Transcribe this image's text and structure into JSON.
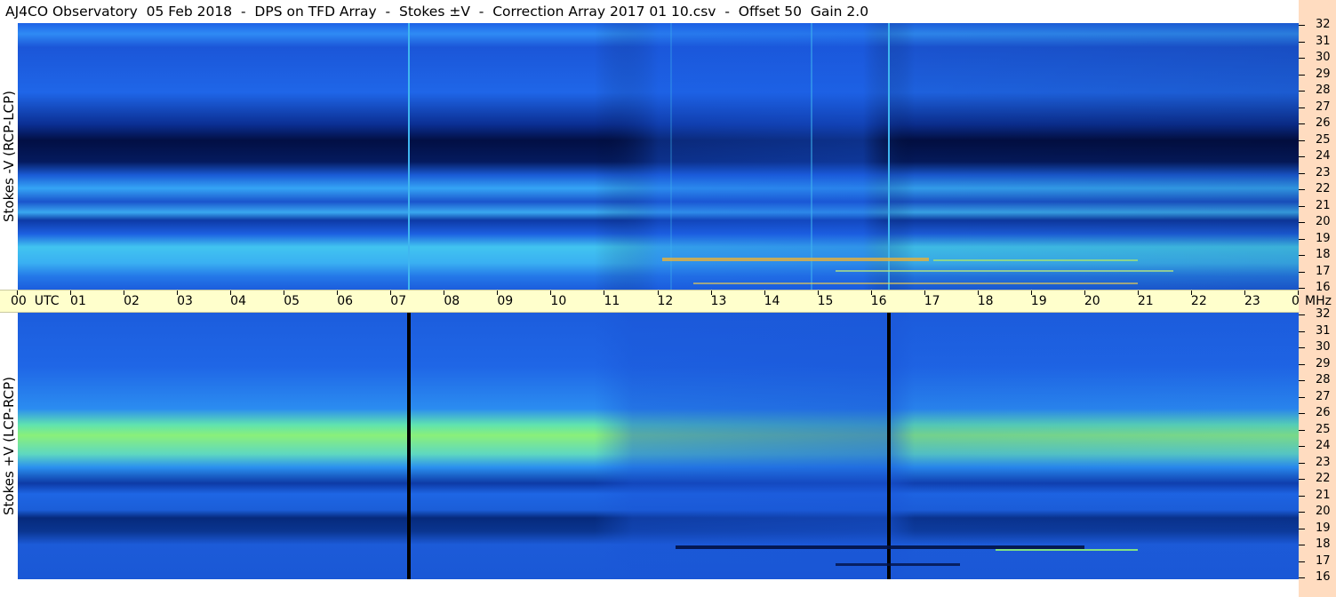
{
  "title": "AJ4CO Observatory  05 Feb 2018  -  DPS on TFD Array  -  Stokes ±V  -  Correction Array 2017 01 10.csv  -  Offset 50  Gain 2.0",
  "top_panel": {
    "label": "Stokes -V (RCP-LCP)"
  },
  "bottom_panel": {
    "label": "Stokes +V (LCP-RCP)"
  },
  "time_axis": {
    "labels": [
      "00  UTC",
      "01",
      "02",
      "03",
      "04",
      "05",
      "06",
      "07",
      "08",
      "09",
      "10",
      "11",
      "12",
      "13",
      "14",
      "15",
      "16",
      "17",
      "18",
      "19",
      "20",
      "21",
      "22",
      "23",
      "00"
    ],
    "unit": "MHz"
  },
  "freq_axis": {
    "labels": [
      "32",
      "31",
      "30",
      "29",
      "28",
      "27",
      "26",
      "25",
      "24",
      "23",
      "22",
      "21",
      "20",
      "19",
      "18",
      "17",
      "16"
    ]
  },
  "colors": {
    "background_blue": "#1e5fe0",
    "dark_band": "#021a5a",
    "bright_band": "#7ff07a",
    "axis_strip": "#ffffcc",
    "freq_strip": "#ffdcc0"
  }
}
